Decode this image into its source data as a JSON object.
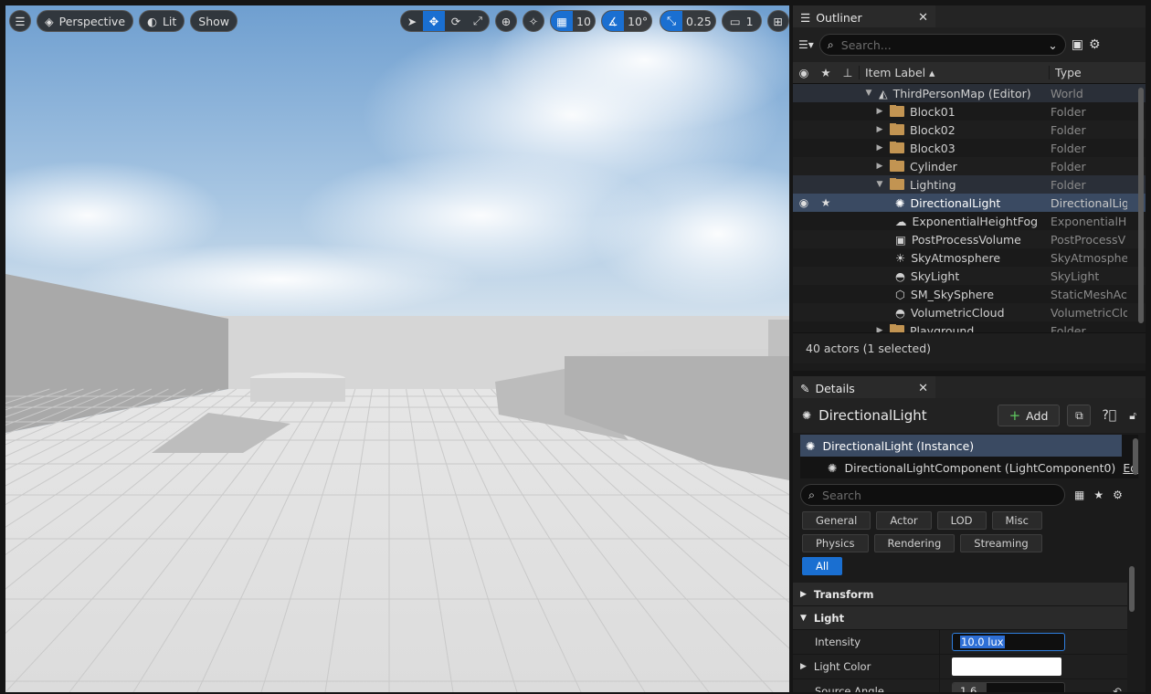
{
  "viewport": {
    "view_mode": "Perspective",
    "lighting_mode": "Lit",
    "show_label": "Show",
    "grid_snap": "10",
    "rotation_snap": "10°",
    "scale_snap": "0.25",
    "camera_speed": "1"
  },
  "outliner": {
    "tab_title": "Outliner",
    "search_placeholder": "Search...",
    "columns": {
      "label": "Item Label ▴",
      "type": "Type"
    },
    "rows": [
      {
        "label": "ThirdPersonMap (Editor)",
        "type": "World"
      },
      {
        "label": "Block01",
        "type": "Folder"
      },
      {
        "label": "Block02",
        "type": "Folder"
      },
      {
        "label": "Block03",
        "type": "Folder"
      },
      {
        "label": "Cylinder",
        "type": "Folder"
      },
      {
        "label": "Lighting",
        "type": "Folder"
      },
      {
        "label": "DirectionalLight",
        "type": "DirectionalLig"
      },
      {
        "label": "ExponentialHeightFog",
        "type": "ExponentialHe"
      },
      {
        "label": "PostProcessVolume",
        "type": "PostProcessV"
      },
      {
        "label": "SkyAtmosphere",
        "type": "SkyAtmosphe"
      },
      {
        "label": "SkyLight",
        "type": "SkyLight"
      },
      {
        "label": "SM_SkySphere",
        "type": "StaticMeshAc"
      },
      {
        "label": "VolumetricCloud",
        "type": "VolumetricClo"
      },
      {
        "label": "Playground",
        "type": "Folder"
      }
    ],
    "footer": "40 actors (1 selected)"
  },
  "details": {
    "tab_title": "Details",
    "actor_name": "DirectionalLight",
    "add_label": "Add",
    "components": [
      {
        "label": "DirectionalLight (Instance)"
      },
      {
        "label": "DirectionalLightComponent (LightComponent0)",
        "link": "Edit i"
      }
    ],
    "search_placeholder": "Search",
    "filters": [
      "General",
      "Actor",
      "LOD",
      "Misc",
      "Physics",
      "Rendering",
      "Streaming",
      "All"
    ],
    "active_filter": "All",
    "sections": {
      "transform": "Transform",
      "light": "Light"
    },
    "properties": {
      "intensity": {
        "label": "Intensity",
        "value": "10.0 lux"
      },
      "light_color": {
        "label": "Light Color"
      },
      "source_angle": {
        "label": "Source Angle",
        "value": "1.6",
        "fill_fraction": 0.3
      }
    }
  }
}
